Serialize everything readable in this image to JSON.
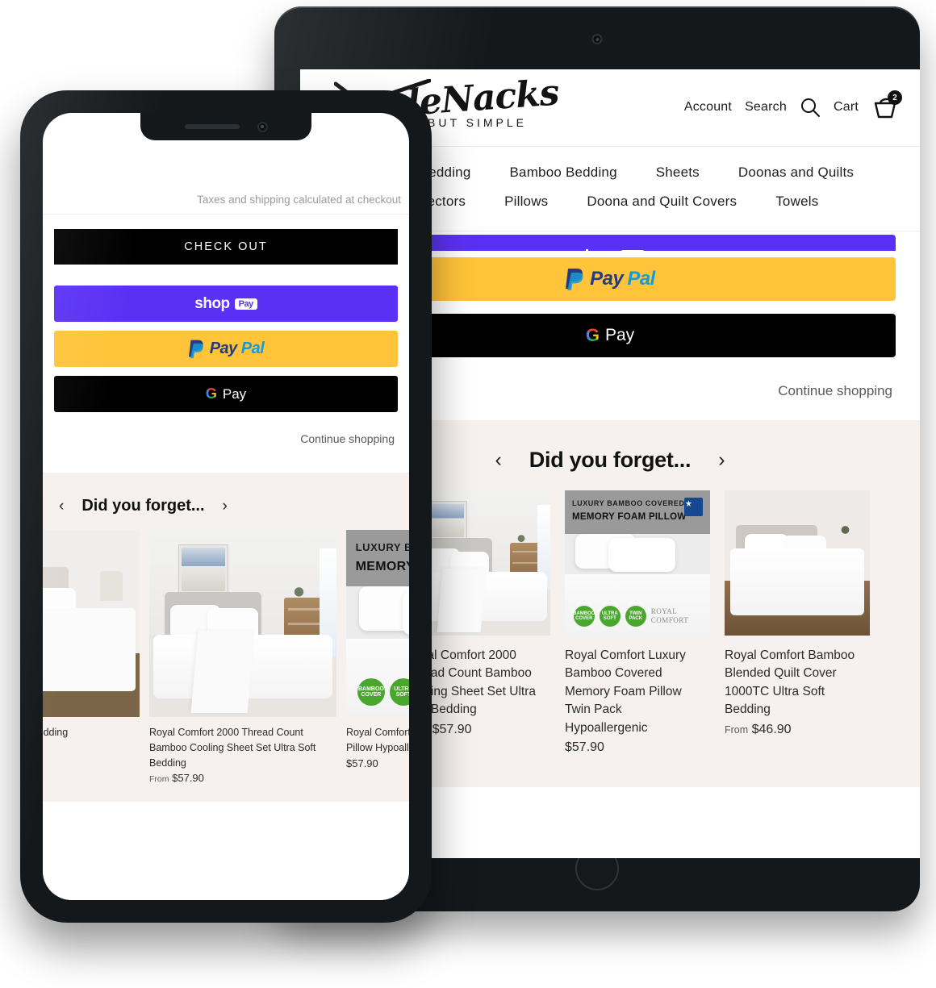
{
  "brand": {
    "logo_script": "leNacks",
    "logo_tagline": "BUT SIMPLE"
  },
  "header": {
    "account_label": "Account",
    "search_label": "Search",
    "cart_label": "Cart",
    "cart_count": "2"
  },
  "nav": {
    "row1": [
      "Organic Bedding",
      "Bamboo Bedding",
      "Sheets",
      "Doonas and Quilts"
    ],
    "row2": [
      "Protectors",
      "Pillows",
      "Doona and Quilt Covers",
      "Towels"
    ]
  },
  "cart": {
    "taxes_note": "Taxes and shipping calculated at checkout",
    "checkout_label": "CHECK OUT",
    "shop_pay_label": "shop",
    "shop_pay_chip": "Pay",
    "paypal_label_1": "Pay",
    "paypal_label_2": "Pal",
    "gpay_g": "G",
    "gpay_label": "Pay",
    "continue_label": "Continue shopping"
  },
  "reco": {
    "title": "Did you forget...",
    "prev_arrow": "‹",
    "next_arrow": "›"
  },
  "tablet_products": [
    {
      "title": "Royal Comfort 2000 Thread Count Bamboo Cooling Sheet Set Ultra Soft Bedding",
      "price": "$57.90",
      "price_prefix": "From",
      "image": "bedroom-sheet-set"
    },
    {
      "title": "Royal Comfort 2000 Thread Count Bamboo Cooling Sheet Set Ultra Soft Bedding",
      "price": "$57.90",
      "price_prefix": "From",
      "image": "bedroom-sheet-set-2"
    },
    {
      "title": "Royal Comfort Luxury Bamboo Covered Memory Foam Pillow Twin Pack Hypoallergenic",
      "price": "$57.90",
      "price_prefix": "",
      "image": "memory-foam-pillow"
    },
    {
      "title": "Royal Comfort Bamboo Blended Quilt Cover 1000TC Ultra Soft Bedding",
      "price": "$46.90",
      "price_prefix": "From",
      "image": "bedroom-quilt-cover"
    }
  ],
  "phone_products": [
    {
      "title": "Count Bamboo ft Bedding",
      "price": "",
      "price_prefix": "",
      "image": "bedroom-sheet-set-clipped"
    },
    {
      "title": "Royal Comfort 2000 Thread Count Bamboo Cooling Sheet Set Ultra Soft Bedding",
      "price": "$57.90",
      "price_prefix": "From",
      "image": "bedroom-sheet-set"
    },
    {
      "title": "Royal Comfort Luxury Memory Foam Pillow Hypoallergenic",
      "price": "$57.90",
      "price_prefix": "",
      "image": "memory-foam-pillow"
    }
  ],
  "pillow_badge": {
    "line1": "LUXURY BAMBOO COVERED",
    "line2": "MEMORY FOAM PILLOW",
    "badge1": "BAMBOO COVER",
    "badge2": "ULTRA SOFT",
    "badge3": "TWIN PACK",
    "brand1": "ROYAL",
    "brand2": "COMFORT"
  },
  "colors": {
    "shop_pay": "#5a31f4",
    "paypal": "#ffc439",
    "gpay": "#000000",
    "reco_band": "#f6f1ee",
    "device_frame": "#14181a"
  }
}
